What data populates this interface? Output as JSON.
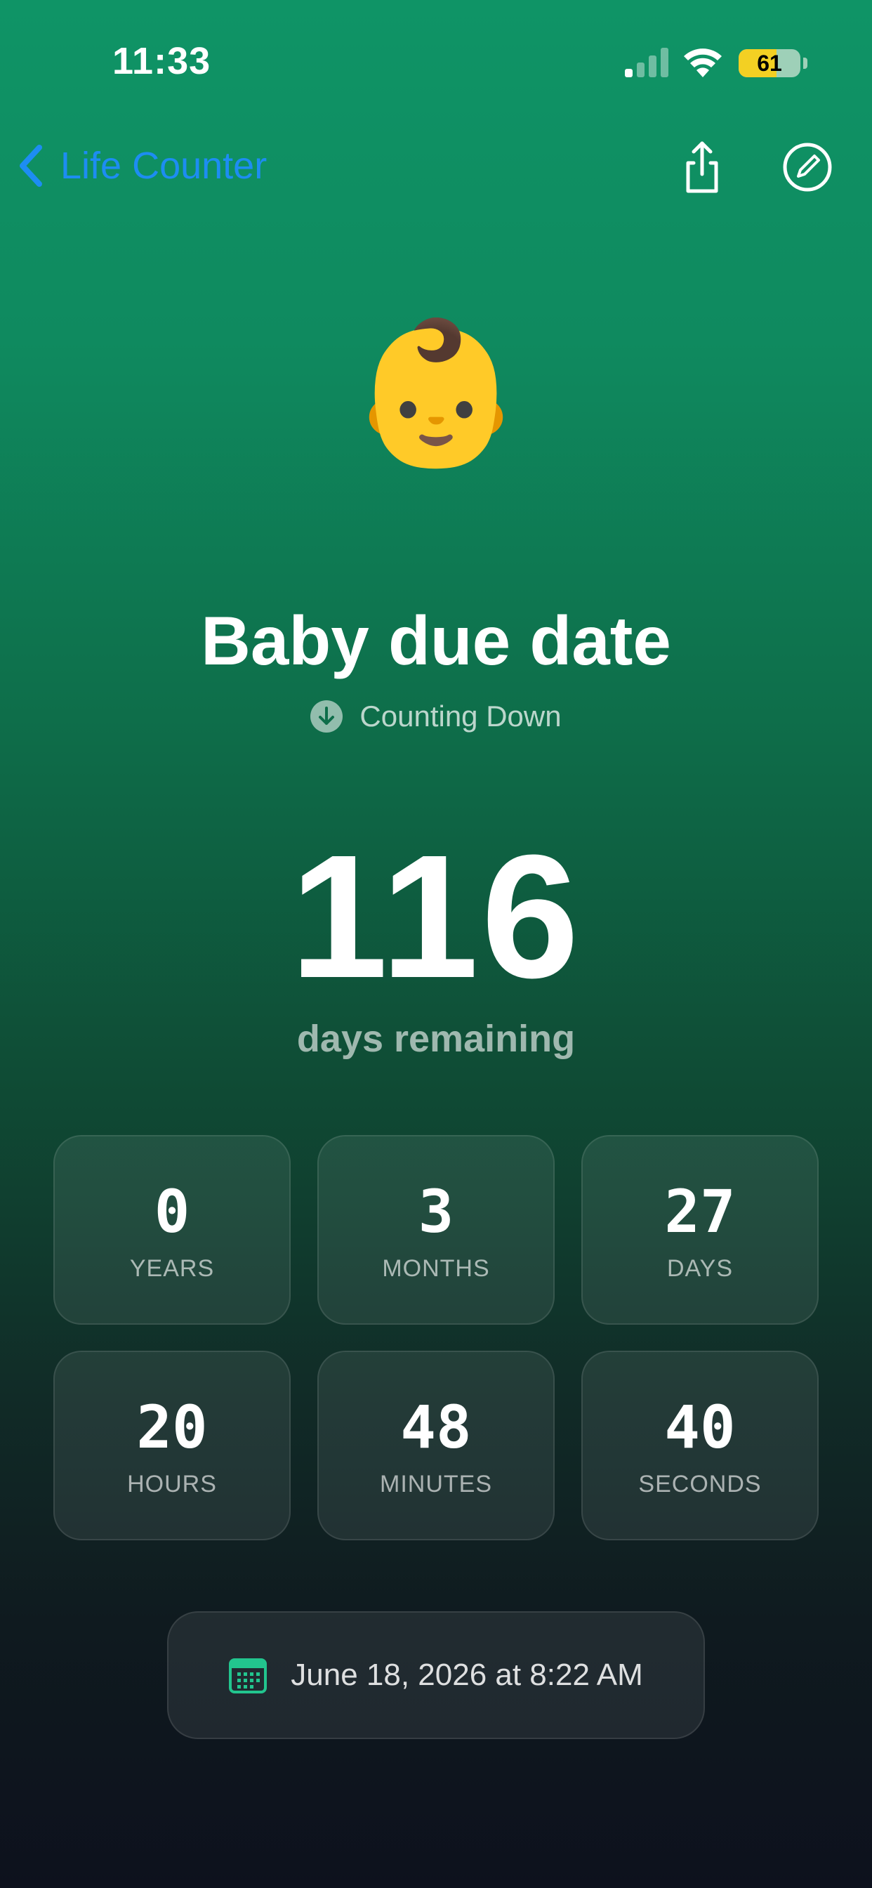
{
  "status_bar": {
    "time": "11:33",
    "battery_percent": 61,
    "battery_label": "61"
  },
  "nav": {
    "back_label": "Life Counter",
    "icons": [
      "chevron-left-icon",
      "share-icon",
      "edit-icon"
    ]
  },
  "counter": {
    "emoji": "👶",
    "title": "Baby due date",
    "mode_label": "Counting Down",
    "mode_icon": "arrow-down-circle-icon",
    "big_value": "116",
    "big_unit": "days remaining"
  },
  "breakdown": [
    {
      "value": "0",
      "label": "YEARS"
    },
    {
      "value": "3",
      "label": "MONTHS"
    },
    {
      "value": "27",
      "label": "DAYS"
    },
    {
      "value": "20",
      "label": "HOURS"
    },
    {
      "value": "48",
      "label": "MINUTES"
    },
    {
      "value": "40",
      "label": "SECONDS"
    }
  ],
  "target_date": {
    "icon": "calendar-icon",
    "text": "June 18, 2026 at 8:22 AM"
  },
  "colors": {
    "accent_blue": "#1d8df2",
    "calendar_green": "#22c58e",
    "battery_yellow": "#f3d023"
  }
}
